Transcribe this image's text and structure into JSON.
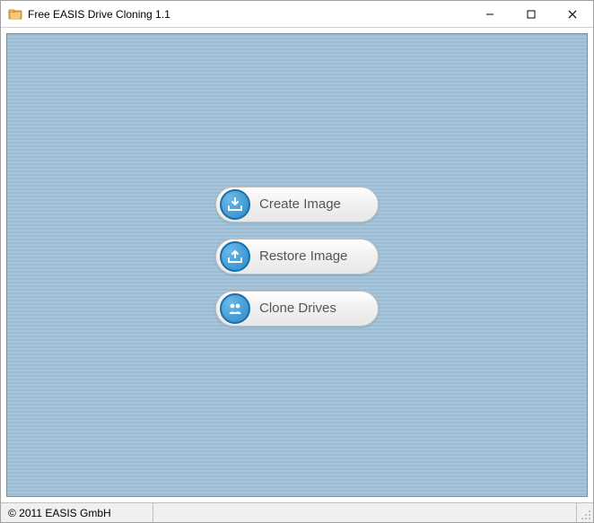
{
  "window": {
    "title": "Free EASIS Drive Cloning 1.1"
  },
  "buttons": {
    "create_image": "Create Image",
    "restore_image": "Restore Image",
    "clone_drives": "Clone Drives"
  },
  "statusbar": {
    "copyright": "© 2011 EASIS GmbH"
  },
  "icons": {
    "app": "app-icon",
    "minimize": "minimize-icon",
    "maximize": "maximize-icon",
    "close": "close-icon",
    "create": "download-tray-icon",
    "restore": "upload-tray-icon",
    "clone": "people-icon"
  }
}
